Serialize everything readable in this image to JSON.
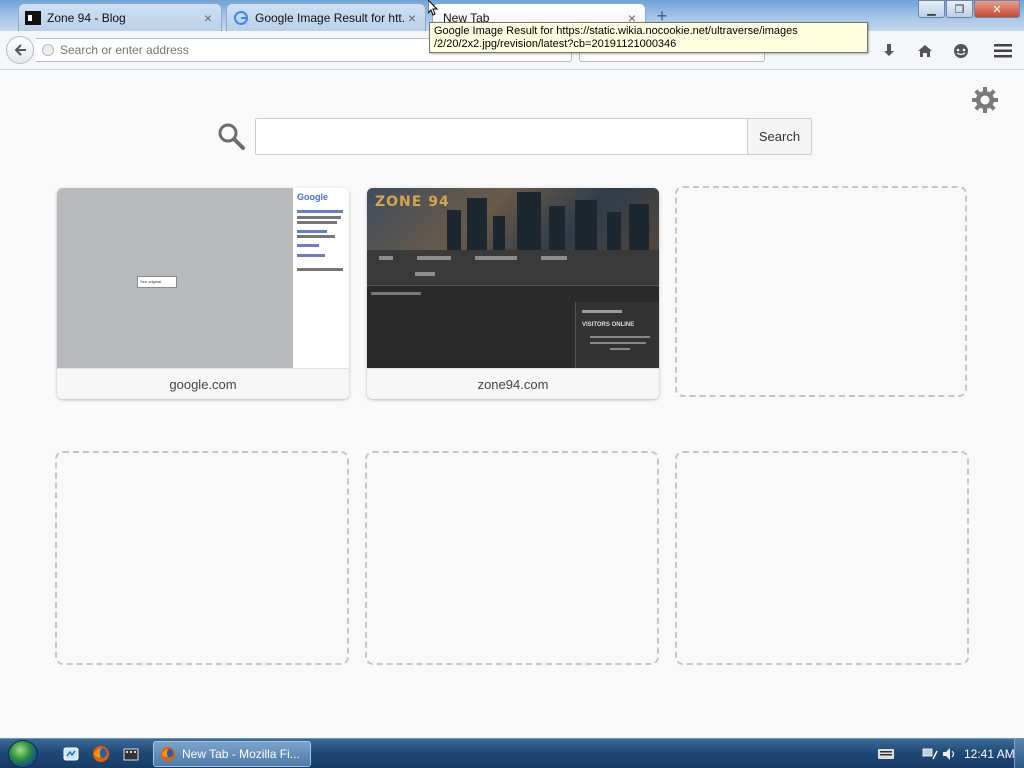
{
  "tabs": [
    {
      "title": "Zone 94 - Blog",
      "icon": "zone94-favicon-icon",
      "active": false
    },
    {
      "title": "Google Image Result for htt...",
      "icon": "google-favicon-icon",
      "active": false
    },
    {
      "title": "New Tab",
      "icon": "none",
      "active": true
    }
  ],
  "tooltip": {
    "line1": "Google Image Result for https://static.wikia.nocookie.net/ultraverse/images",
    "line2": "/2/20/2x2.jpg/revision/latest?cb=20191121000346"
  },
  "navbar": {
    "url_placeholder": "Search or enter address",
    "icons": [
      "back-arrow-icon",
      "download-icon",
      "home-icon",
      "chat-icon",
      "menu-icon"
    ]
  },
  "content": {
    "search_button": "Search",
    "tiles": [
      {
        "label": "google.com",
        "type": "filled"
      },
      {
        "label": "zone94.com",
        "type": "filled"
      },
      {
        "label": "",
        "type": "empty"
      },
      {
        "label": "",
        "type": "empty"
      },
      {
        "label": "",
        "type": "empty"
      },
      {
        "label": "",
        "type": "empty"
      }
    ],
    "google_thumb": {
      "logo": "Google",
      "popup": "See original"
    },
    "zone_thumb": {
      "logo": "ZONE 94",
      "panel_title": "VISITORS ONLINE"
    }
  },
  "taskbar": {
    "task_label": "New Tab - Mozilla Fi...",
    "clock": "12:41 AM"
  },
  "colors": {
    "tab_bar": "#a9c8e8",
    "taskbar": "#1f4a78",
    "page_bg": "#f9f9fa"
  }
}
